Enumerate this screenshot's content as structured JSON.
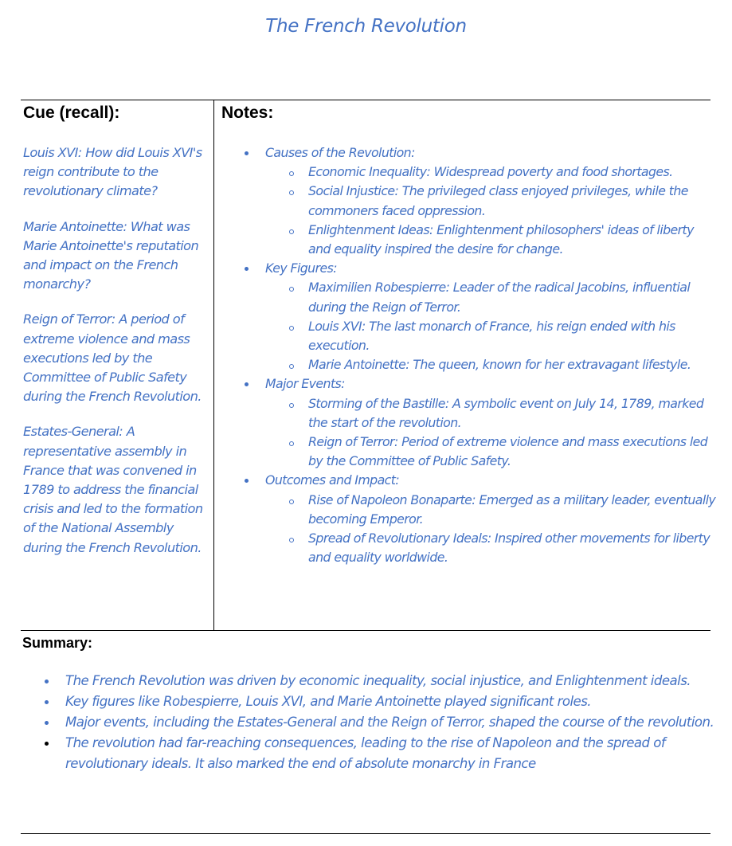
{
  "document": {
    "title": "The French Revolution"
  },
  "cue": {
    "heading": "Cue (recall):",
    "items": [
      "Louis XVI: How did Louis XVI's reign contribute to the revolutionary climate?",
      "Marie Antoinette: What was Marie Antoinette's reputation and impact on the French monarchy?",
      "Reign of Terror: A period of extreme violence and mass executions led by the Committee of Public Safety during the French Revolution.",
      "Estates-General: A representative assembly in France that was convened in 1789 to address the financial crisis and led to the formation of the National Assembly during the French Revolution."
    ]
  },
  "notes": {
    "heading": "Notes:",
    "sections": [
      {
        "label": "Causes of the Revolution:",
        "items": [
          "Economic Inequality: Widespread poverty and food shortages.",
          "Social Injustice: The privileged class enjoyed privileges, while the commoners faced oppression.",
          "Enlightenment Ideas: Enlightenment philosophers' ideas of liberty and equality inspired the desire for change."
        ]
      },
      {
        "label": "Key Figures:",
        "items": [
          "Maximilien Robespierre: Leader of the radical Jacobins, influential during the Reign of Terror.",
          "Louis XVI: The last monarch of France, his reign ended with his execution.",
          "Marie Antoinette: The queen, known for her extravagant lifestyle."
        ]
      },
      {
        "label": "Major Events:",
        "items": [
          "Storming of the Bastille: A symbolic event on July 14, 1789, marked the start of the revolution.",
          "Reign of Terror: Period of extreme violence and mass executions led by the Committee of Public Safety."
        ]
      },
      {
        "label": "Outcomes and Impact:",
        "items": [
          "Rise of Napoleon Bonaparte: Emerged as a military leader, eventually becoming Emperor.",
          "Spread of Revolutionary Ideals: Inspired other movements for liberty and equality worldwide."
        ]
      }
    ]
  },
  "summary": {
    "heading": "Summary:",
    "items": [
      "The French Revolution was driven by economic inequality, social injustice, and Enlightenment ideals.",
      "Key figures like Robespierre, Louis XVI, and Marie Antoinette played significant roles.",
      "Major events, including the Estates-General and the Reign of Terror, shaped the course of the revolution.",
      "The revolution had far-reaching consequences, leading to the rise of Napoleon and the spread of revolutionary ideals. It also marked the end of absolute monarchy in France"
    ]
  },
  "colors": {
    "ink": "#4472c4",
    "rule": "#000000"
  }
}
